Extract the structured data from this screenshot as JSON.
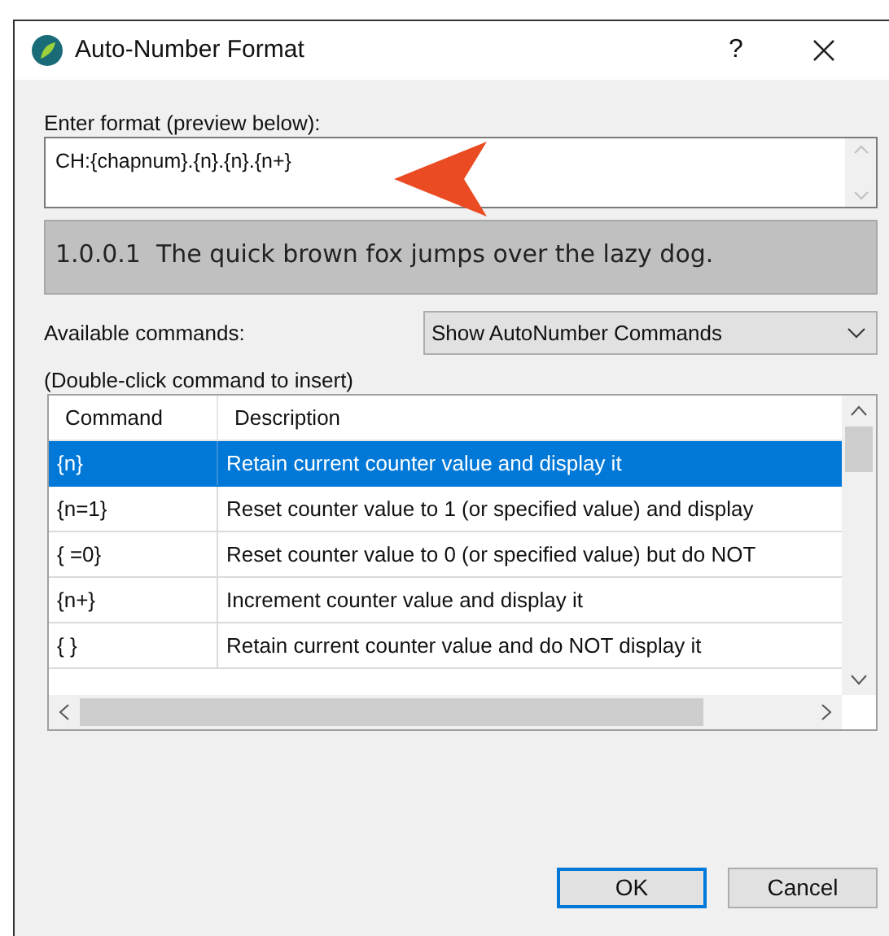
{
  "window": {
    "title": "Auto-Number Format",
    "help": "?"
  },
  "format": {
    "label": "Enter format (preview below):",
    "value": "CH:{chapnum}.{n}.{n}.{n+}"
  },
  "preview": "1.0.0.1  The quick brown fox jumps over the lazy dog.",
  "commands": {
    "label": "Available commands:",
    "dropdown": "Show AutoNumber Commands"
  },
  "hint": "(Double-click command to insert)",
  "table": {
    "columns": [
      "Command",
      "Description"
    ],
    "rows": [
      {
        "command": "{n}",
        "description": "Retain current counter value and display it",
        "selected": true
      },
      {
        "command": "{n=1}",
        "description": "Reset counter value to 1 (or specified value) and display",
        "selected": false
      },
      {
        "command": "{ =0}",
        "description": "Reset counter value to 0 (or specified value) but do NOT",
        "selected": false
      },
      {
        "command": "{n+}",
        "description": "Increment counter value and display it",
        "selected": false
      },
      {
        "command": "{ }",
        "description": "Retain current counter value and do NOT display it",
        "selected": false
      }
    ]
  },
  "buttons": [
    {
      "label": "OK",
      "default": true
    },
    {
      "label": "Cancel",
      "default": false
    }
  ]
}
